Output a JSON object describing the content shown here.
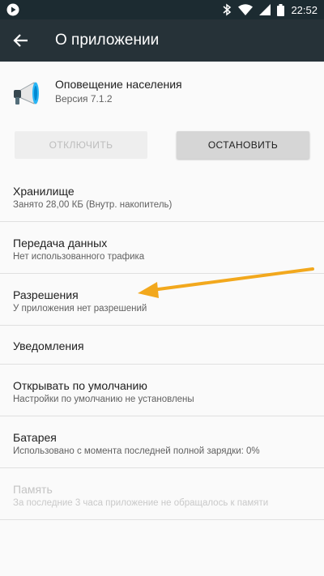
{
  "status_bar": {
    "time": "22:52",
    "icons": [
      "bluetooth-icon",
      "wifi-icon",
      "battery-icon",
      "play-icon"
    ]
  },
  "app_bar": {
    "title": "О приложении",
    "back_icon": "arrow-back-icon"
  },
  "app": {
    "name": "Оповещение населения",
    "version": "Версия 7.1.2",
    "icon": "megaphone-icon"
  },
  "buttons": {
    "disable_label": "ОТКЛЮЧИТЬ",
    "stop_label": "ОСТАНОВИТЬ"
  },
  "settings": [
    {
      "title": "Хранилище",
      "subtitle": "Занято 28,00 КБ (Внутр. накопитель)"
    },
    {
      "title": "Передача данных",
      "subtitle": "Нет использованного трафика"
    },
    {
      "title": "Разрешения",
      "subtitle": "У приложения нет разрешений"
    },
    {
      "title": "Уведомления",
      "subtitle": ""
    },
    {
      "title": "Открывать по умолчанию",
      "subtitle": "Настройки по умолчанию не установлены"
    },
    {
      "title": "Батарея",
      "subtitle": "Использовано с момента последней полной зарядки: 0%"
    },
    {
      "title": "Память",
      "subtitle": "За последние 3 часа приложение не обращалось к памяти"
    }
  ],
  "colors": {
    "status_bar": "#1c2b31",
    "app_bar": "#263238",
    "annotation_arrow": "#f2a81d"
  }
}
